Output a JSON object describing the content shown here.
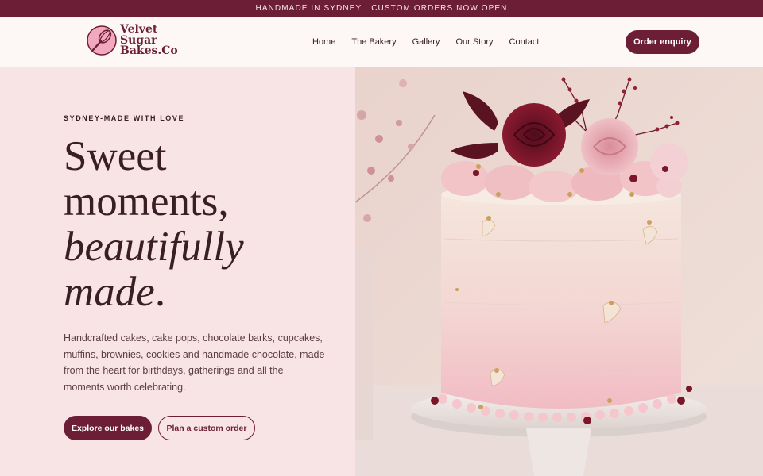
{
  "announcement": "HANDMADE IN SYDNEY · CUSTOM ORDERS NOW OPEN",
  "brand": {
    "line1": "Velvet",
    "line2": "Sugar",
    "line3": "Bakes.Co"
  },
  "nav": {
    "items": [
      {
        "label": "Home"
      },
      {
        "label": "The Bakery"
      },
      {
        "label": "Gallery"
      },
      {
        "label": "Our Story"
      },
      {
        "label": "Contact"
      }
    ],
    "cta_label": "Order enquiry"
  },
  "hero": {
    "eyebrow": "SYDNEY-MADE WITH LOVE",
    "headline_line1": "Sweet",
    "headline_line2": "moments,",
    "headline_line3": "beautifully",
    "headline_line4": "made",
    "headline_punct": ".",
    "description": "Handcrafted cakes, cake pops, chocolate barks, cupcakes, muffins, brownies, cookies and handmade chocolate, made from the heart for birthdays, gatherings and all the moments worth celebrating.",
    "primary_label": "Explore our bakes",
    "secondary_label": "Plan a custom order"
  },
  "colors": {
    "brand": "#6b1e36",
    "hero_bg": "#f8e4e4",
    "nav_bg": "#fdf8f5"
  }
}
